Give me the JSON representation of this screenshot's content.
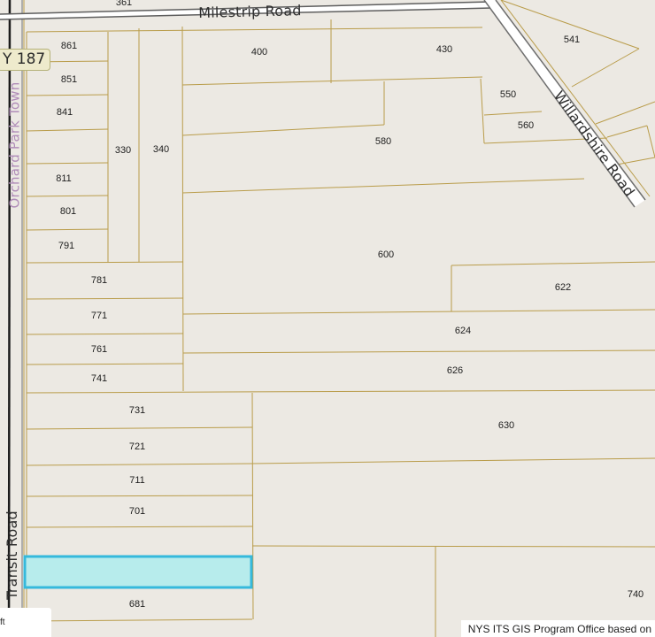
{
  "map": {
    "roads": {
      "milestrip": "Milestrip Road",
      "willardshire": "Willardshire Road",
      "transit": "Transit Road",
      "orchard_park": "Orchard Park Town"
    },
    "route_shield": "Y 187",
    "top_edge_number": "361",
    "parcels": {
      "p861": "861",
      "p851": "851",
      "p841": "841",
      "p811": "811",
      "p801": "801",
      "p791": "791",
      "p781": "781",
      "p771": "771",
      "p761": "761",
      "p741": "741",
      "p731": "731",
      "p721": "721",
      "p711": "711",
      "p701": "701",
      "p681": "681",
      "p330": "330",
      "p340": "340",
      "p400": "400",
      "p430": "430",
      "p541": "541",
      "p550": "550",
      "p560": "560",
      "p580": "580",
      "p600": "600",
      "p622": "622",
      "p624": "624",
      "p626": "626",
      "p630": "630",
      "p740": "740"
    },
    "highlight_color": "#b7ecec",
    "highlight_border": "#35b9dc",
    "parcel_line_color": "#b99c4a",
    "scale_unit": "ft",
    "attribution": "NYS ITS GIS Program Office based on"
  }
}
